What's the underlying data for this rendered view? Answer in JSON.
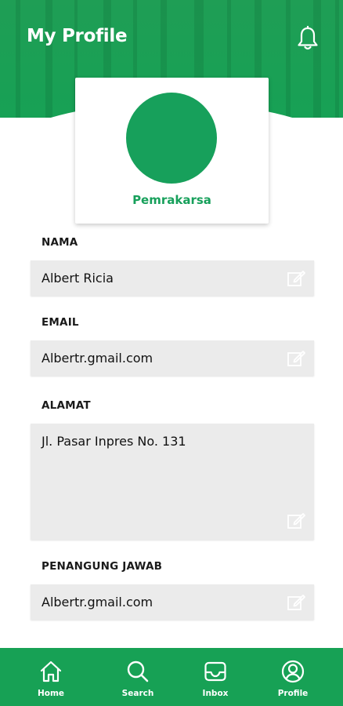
{
  "header": {
    "title": "My Profile",
    "bell_icon": "bell-icon",
    "color": "#17a155"
  },
  "profile": {
    "role": "Pemrakarsa",
    "avatar_color": "#17a05b"
  },
  "fields": [
    {
      "label": "NAMA",
      "value": "Albert Ricia",
      "icon": "edit-icon"
    },
    {
      "label": "EMAIL",
      "value": "Albertr.gmail.com",
      "icon": "edit-icon"
    },
    {
      "label": "ALAMAT",
      "value": "Jl. Pasar Inpres No. 131",
      "icon": "edit-icon"
    },
    {
      "label": "PENANGUNG JAWAB",
      "value": "Albertr.gmail.com",
      "icon": "edit-icon"
    }
  ],
  "nav": [
    {
      "label": "Home",
      "icon": "home-icon"
    },
    {
      "label": "Search",
      "icon": "search-icon"
    },
    {
      "label": "Inbox",
      "icon": "inbox-icon"
    },
    {
      "label": "Profile",
      "icon": "profile-icon"
    }
  ]
}
